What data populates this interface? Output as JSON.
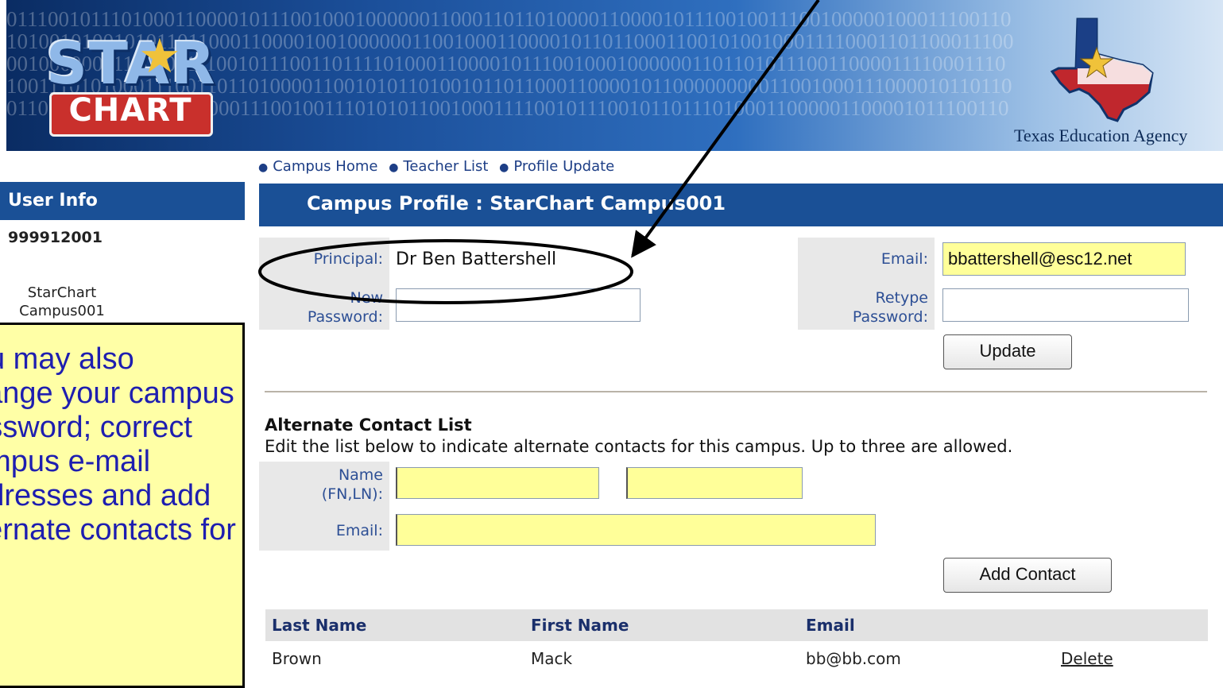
{
  "header": {
    "binary_rows": [
      "01110010111010001100001011100100010000001100011011010000110000101110010011100100000100011100110",
      "10100101001010110110001100001001000000110010001100001011011000110010100100011110001101100011100",
      "00100000011110001111001011100110111101000110000101110010001000000110110101110011000011110001110",
      "10011101010001110011011010000110010101101001011011000110000101100000000011001000111000010110110",
      "01101001010100111010001110010011101010110010001111001011100101101110100011000001100001011100110"
    ],
    "logo": {
      "top": "STAR",
      "bottom": "CHART"
    },
    "agency": "Texas Education Agency"
  },
  "nav": {
    "items": [
      "Campus Home",
      "Teacher List",
      "Profile Update"
    ]
  },
  "sidebar": {
    "title": "User Info",
    "user_id": "999912001",
    "campus_line1": "StarChart",
    "campus_line2": "Campus001"
  },
  "tooltip": {
    "text": "You may also change your campus password; correct campus e-mail addresses and add alternate contacts for"
  },
  "profile": {
    "title": "Campus Profile : StarChart Campus001",
    "principal_label": "Principal:",
    "principal_value": "Dr Ben Battershell",
    "new_password_label_1": "New",
    "new_password_label_2": "Password:",
    "new_password_value": "",
    "email_label": "Email:",
    "email_value": "bbattershell@esc12.net",
    "retype_label_1": "Retype",
    "retype_label_2": "Password:",
    "retype_value": "",
    "update_label": "Update"
  },
  "alternate": {
    "title": "Alternate Contact List",
    "description": "Edit the list below to indicate alternate contacts for this campus.  Up to three are allowed.",
    "name_label_1": "Name",
    "name_label_2": "(FN,LN):",
    "first_name_value": "",
    "last_name_value": "",
    "email_label": "Email:",
    "email_value": "",
    "add_label": "Add Contact"
  },
  "contacts": {
    "columns": [
      "Last Name",
      "First Name",
      "Email",
      ""
    ],
    "rows": [
      {
        "last": "Brown",
        "first": "Mack",
        "email": "bb@bb.com",
        "action": "Delete"
      }
    ]
  },
  "colors": {
    "header_blue": "#1a5096",
    "label_bg": "#e8e8e8",
    "input_yellow": "#ffff99",
    "tooltip_bg": "#ffffa6",
    "tooltip_text": "#1e1eb0"
  },
  "icons": {
    "logo": "starchart-logo",
    "state": "texas-flag-map-icon",
    "nav_bullet": "bullet-dot-icon"
  }
}
